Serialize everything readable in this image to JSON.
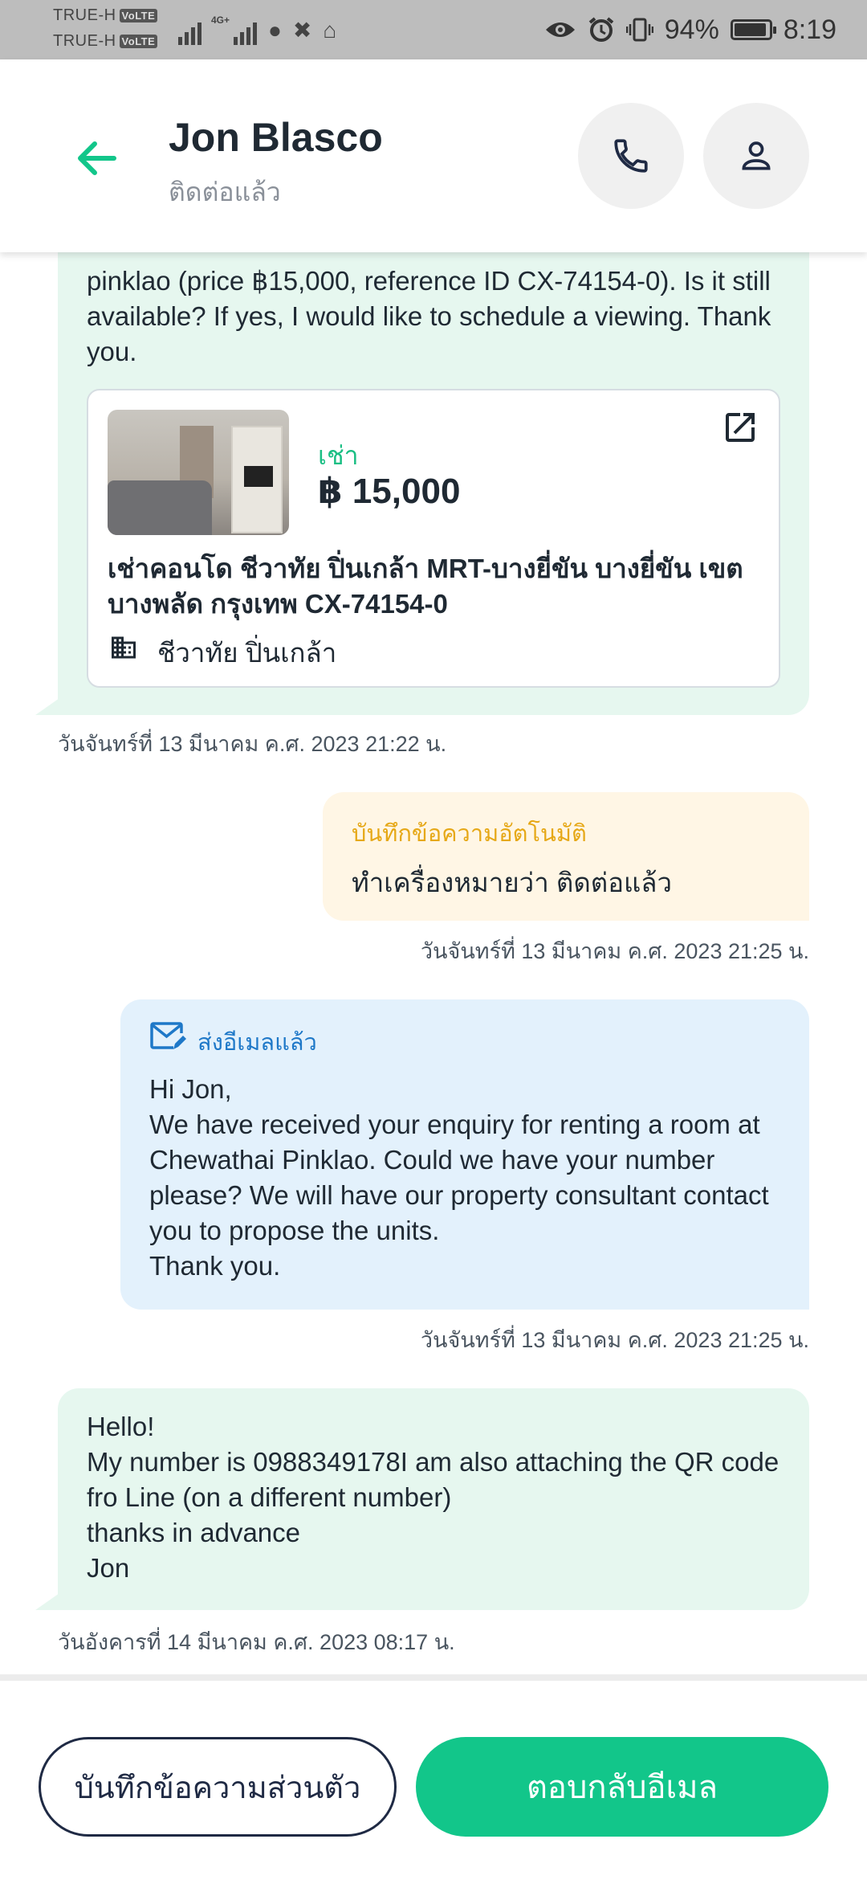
{
  "status_bar": {
    "carrier_1": "TRUE-H",
    "carrier_2": "TRUE-H",
    "volte": "VoLTE",
    "network_badge": "4G+",
    "battery_percent": "94%",
    "battery_level": 0.94,
    "time": "8:19",
    "icons": [
      "signal-icon",
      "line-icon",
      "gmail-icon",
      "hotspot-icon",
      "eye-icon",
      "alarm-icon",
      "vibrate-icon",
      "battery-icon"
    ]
  },
  "header": {
    "contact_name": "Jon Blasco",
    "contact_status": "ติดต่อแล้ว",
    "accent_color": "#12c68a"
  },
  "messages": {
    "m1": {
      "text": "pinklao (price ฿15,000, reference ID CX-74154-0). Is it still available? If yes, I would like to schedule a viewing. Thank you.",
      "listing": {
        "type_label": "เช่า",
        "price": "฿ 15,000",
        "title": "เช่าคอนโด  ชีวาทัย ปิ่นเกล้า MRT-บางยี่ขัน บางยี่ขัน เขต บางพลัด กรุงเทพ CX-74154-0",
        "building": "ชีวาทัย ปิ่นเกล้า"
      },
      "timestamp": "วันจันทร์ที่ 13 มีนาคม ค.ศ. 2023 21:22 น."
    },
    "m2": {
      "label": "บันทึกข้อความอัตโนมัติ",
      "text": "ทำเครื่องหมายว่า ติดต่อแล้ว",
      "timestamp": "วันจันทร์ที่ 13 มีนาคม ค.ศ. 2023 21:25 น."
    },
    "m3": {
      "label": "ส่งอีเมลแล้ว",
      "text": "Hi Jon,\nWe have received your enquiry for renting a room at Chewathai Pinklao. Could we have your number please? We will have our property consultant contact you to propose the units.\nThank you.",
      "timestamp": "วันจันทร์ที่ 13 มีนาคม ค.ศ. 2023 21:25 น."
    },
    "m4": {
      "text": "Hello!\nMy number is 0988349178I am also attaching the QR code fro Line (on a different number)\nthanks in advance\nJon",
      "timestamp": "วันอังคารที่ 14 มีนาคม ค.ศ. 2023 08:17 น."
    }
  },
  "footer": {
    "private_note_label": "บันทึกข้อความส่วนตัว",
    "reply_email_label": "ตอบกลับอีเมล"
  }
}
